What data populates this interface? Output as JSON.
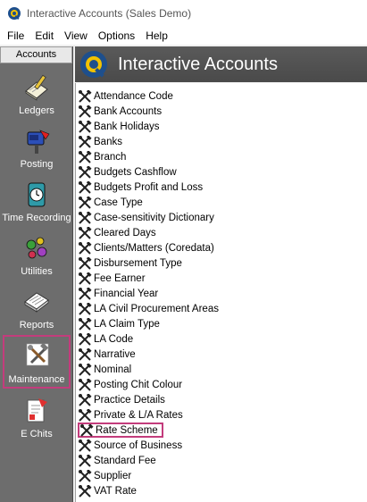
{
  "window": {
    "title": "Interactive Accounts (Sales Demo)"
  },
  "menu": [
    "File",
    "Edit",
    "View",
    "Options",
    "Help"
  ],
  "sidebar": {
    "header": "Accounts",
    "items": [
      {
        "label": "Ledgers",
        "icon": "ledgers-icon"
      },
      {
        "label": "Posting",
        "icon": "posting-icon"
      },
      {
        "label": "Time Recording",
        "icon": "clock-icon"
      },
      {
        "label": "Utilities",
        "icon": "utilities-icon"
      },
      {
        "label": "Reports",
        "icon": "reports-icon"
      },
      {
        "label": "Maintenance",
        "icon": "tools-icon",
        "selected": true
      },
      {
        "label": "E Chits",
        "icon": "echits-icon"
      }
    ]
  },
  "banner": {
    "title": "Interactive Accounts"
  },
  "list": {
    "items": [
      "Attendance Code",
      "Bank Accounts",
      "Bank Holidays",
      "Banks",
      "Branch",
      "Budgets Cashflow",
      "Budgets Profit and Loss",
      "Case Type",
      "Case-sensitivity Dictionary",
      "Cleared Days",
      "Clients/Matters (Coredata)",
      "Disbursement Type",
      "Fee Earner",
      "Financial Year",
      "LA Civil Procurement Areas",
      "LA Claim Type",
      "LA Code",
      "Narrative",
      "Nominal",
      "Posting Chit Colour",
      "Practice Details",
      "Private & L/A Rates",
      "Rate Scheme",
      "Source of Business",
      "Standard Fee",
      "Supplier",
      "VAT Rate"
    ],
    "highlighted": "Rate Scheme"
  },
  "colors": {
    "sidebar": "#6d6d6d",
    "banner": "#4a4a4a",
    "highlight": "#c33c7c"
  }
}
